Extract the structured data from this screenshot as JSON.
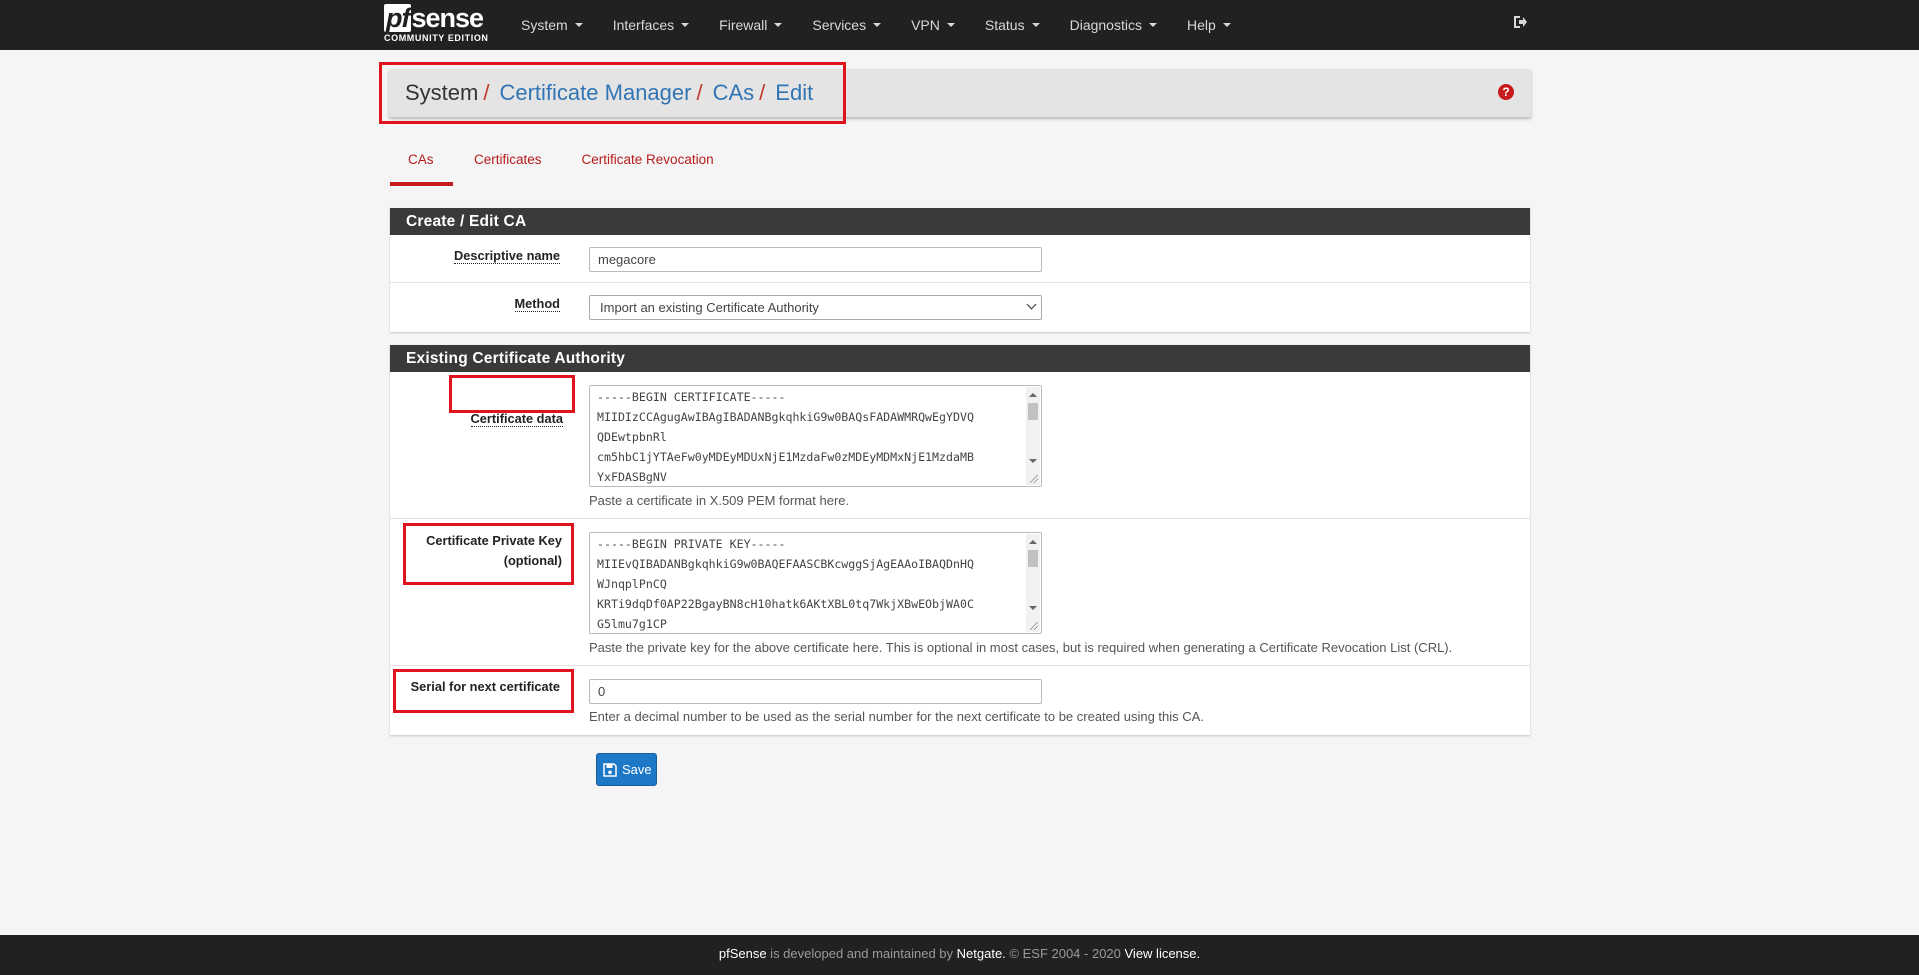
{
  "brand": {
    "name_left": "pf",
    "name_right": "sense",
    "edition": "COMMUNITY EDITION"
  },
  "nav": {
    "items": [
      {
        "label": "System"
      },
      {
        "label": "Interfaces"
      },
      {
        "label": "Firewall"
      },
      {
        "label": "Services"
      },
      {
        "label": "VPN"
      },
      {
        "label": "Status"
      },
      {
        "label": "Diagnostics"
      },
      {
        "label": "Help"
      }
    ],
    "logout_icon": "sign-out-icon"
  },
  "breadcrumb": {
    "system": "System",
    "certificate_manager": "Certificate Manager",
    "cas": "CAs",
    "edit": "Edit",
    "separator": "/",
    "help_icon": "question-circle-icon"
  },
  "tabs": [
    {
      "label": "CAs",
      "active": true
    },
    {
      "label": "Certificates",
      "active": false
    },
    {
      "label": "Certificate Revocation",
      "active": false
    }
  ],
  "create_panel": {
    "heading": "Create / Edit CA",
    "descriptive_name": {
      "label": "Descriptive name",
      "value": "megacore"
    },
    "method": {
      "label": "Method",
      "value": "Import an existing Certificate Authority"
    }
  },
  "existing_panel": {
    "heading": "Existing Certificate Authority",
    "certificate_data": {
      "label": "Certificate data",
      "lines": [
        "-----BEGIN CERTIFICATE-----",
        "MIIDIzCCAgugAwIBAgIBADANBgkqhkiG9w0BAQsFADAWMRQwEgYDVQ",
        "QDEwtpbnRl",
        "cm5hbC1jYTAeFw0yMDEyMDUxNjE1MzdaFw0zMDEyMDMxNjE1MzdaMB",
        "YxFDASBgNV"
      ],
      "help": "Paste a certificate in X.509 PEM format here."
    },
    "private_key": {
      "label_line1": "Certificate Private Key",
      "label_line2": "(optional)",
      "lines": [
        "-----BEGIN PRIVATE KEY-----",
        "MIIEvQIBADANBgkqhkiG9w0BAQEFAASCBKcwggSjAgEAAoIBAQDnHQ",
        "WJnqplPnCQ",
        "KRTi9dqDf0AP22BgayBN8cH10hatk6AKtXBL0tq7WkjXBwEObjWA0C",
        "G5lmu7g1CP"
      ],
      "help": "Paste the private key for the above certificate here. This is optional in most cases, but is required when generating a Certificate Revocation List (CRL)."
    },
    "serial": {
      "label": "Serial for next certificate",
      "value": "0",
      "help": "Enter a decimal number to be used as the serial number for the next certificate to be created using this CA."
    }
  },
  "save_button": {
    "label": "Save",
    "icon": "save-icon"
  },
  "footer": {
    "product": "pfSense",
    "text1": " is developed and maintained by ",
    "company": "Netgate.",
    "text2": " © ESF 2004 - 2020 ",
    "license": "View license."
  },
  "colors": {
    "accent": "#c71c1c",
    "link": "#3275b5",
    "navbar": "#212121",
    "button": "#1e78c8"
  }
}
